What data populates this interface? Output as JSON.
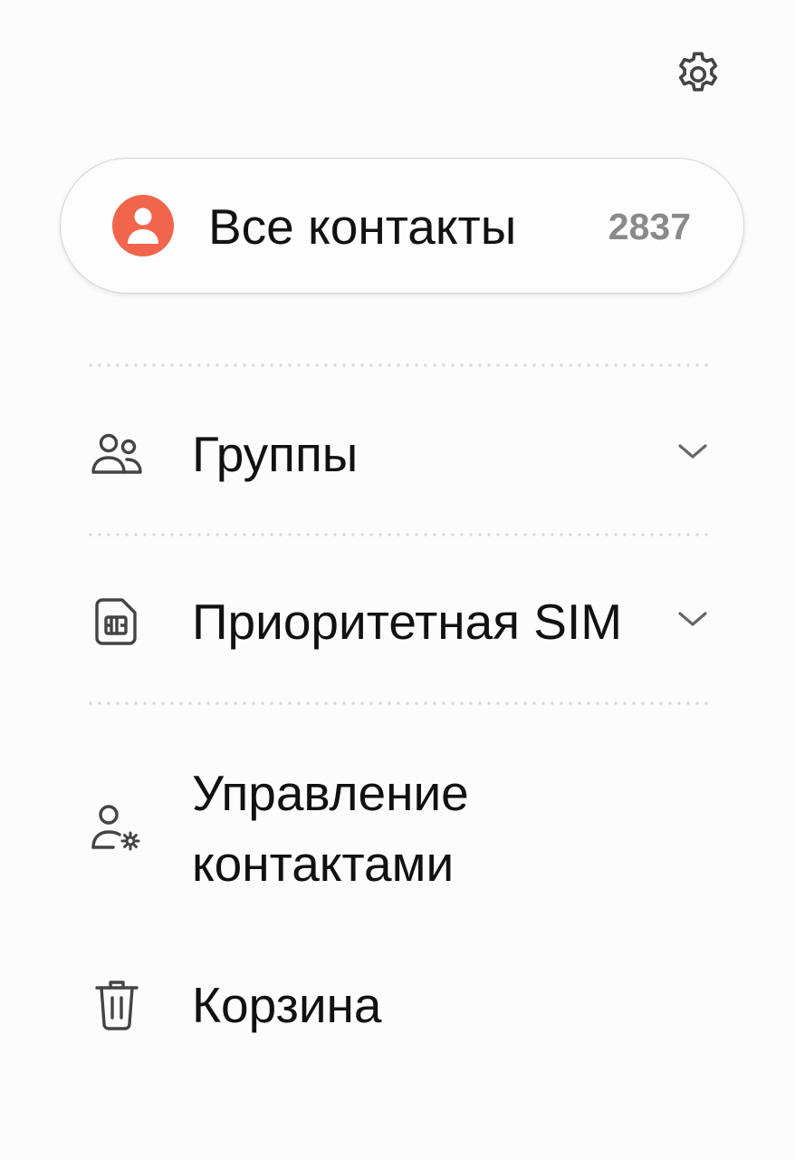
{
  "settings": {
    "icon": "gear-icon"
  },
  "all_contacts": {
    "label": "Все контакты",
    "count": "2837",
    "avatar_color": "#f2654d",
    "icon": "person-icon"
  },
  "menu": [
    {
      "label": "Группы",
      "icon": "group-icon",
      "expandable": true
    },
    {
      "label": "Приоритетная SIM",
      "icon": "sim-card-icon",
      "expandable": true
    },
    {
      "label": "Управление контактами",
      "icon": "manage-contacts-icon",
      "expandable": false
    },
    {
      "label": "Корзина",
      "icon": "trash-icon",
      "expandable": false
    }
  ]
}
